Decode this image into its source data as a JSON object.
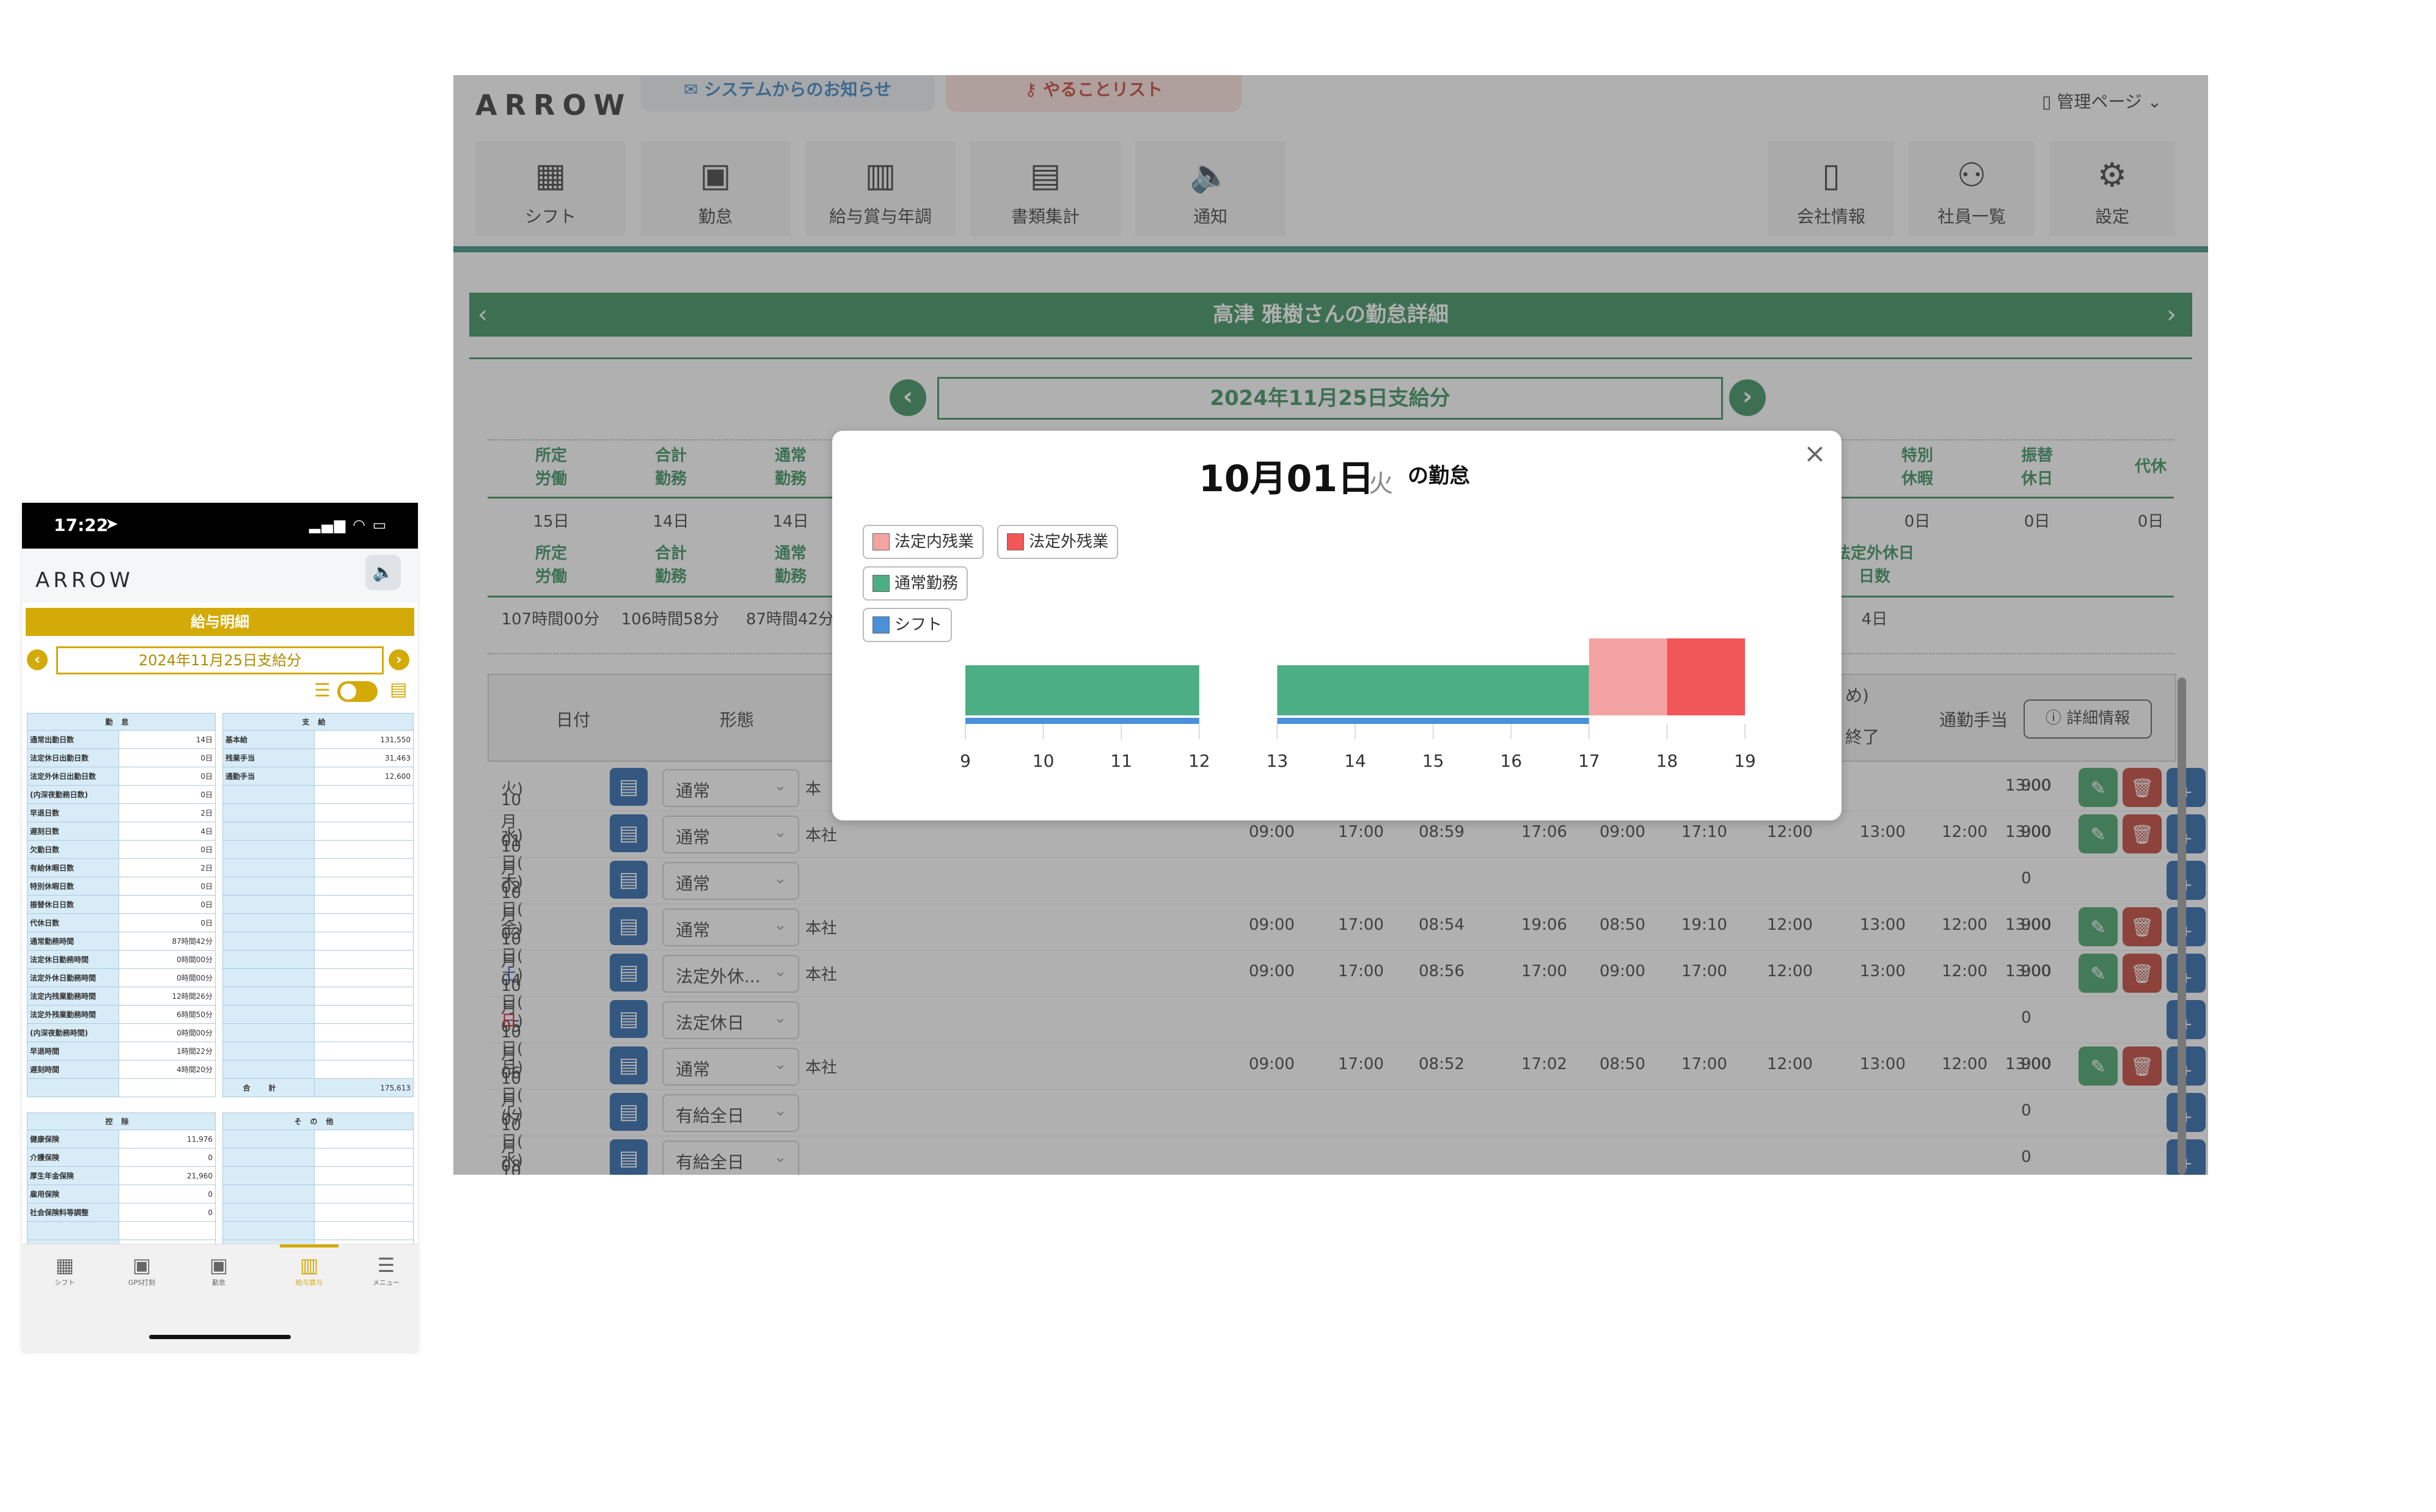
{
  "phone": {
    "status_time": "17:22",
    "logo": "ARROW",
    "title": "給与明細",
    "period": "2024年11月25日支給分",
    "attendance": {
      "header": "勤怠",
      "rows": [
        {
          "label": "通常出勤日数",
          "value": "14日"
        },
        {
          "label": "法定休日出勤日数",
          "value": "0日"
        },
        {
          "label": "法定外休日出勤日数",
          "value": "0日"
        },
        {
          "label": "(内深夜勤務日数)",
          "value": "0日"
        },
        {
          "label": "早退日数",
          "value": "2日"
        },
        {
          "label": "遅刻日数",
          "value": "4日"
        },
        {
          "label": "欠勤日数",
          "value": "0日"
        },
        {
          "label": "有給休暇日数",
          "value": "2日"
        },
        {
          "label": "特別休暇日数",
          "value": "0日"
        },
        {
          "label": "振替休日日数",
          "value": "0日"
        },
        {
          "label": "代休日数",
          "value": "0日"
        },
        {
          "label": "通常勤務時間",
          "value": "87時間42分"
        },
        {
          "label": "法定休日勤務時間",
          "value": "0時間00分"
        },
        {
          "label": "法定外休日勤務時間",
          "value": "0時間00分"
        },
        {
          "label": "法定内残業勤務時間",
          "value": "12時間26分"
        },
        {
          "label": "法定外残業勤務時間",
          "value": "6時間50分"
        },
        {
          "label": "(内深夜勤務時間)",
          "value": "0時間00分"
        },
        {
          "label": "早退時間",
          "value": "1時間22分"
        },
        {
          "label": "遅刻時間",
          "value": "4時間20分"
        }
      ]
    },
    "payment": {
      "header": "支給",
      "rows": [
        {
          "label": "基本給",
          "value": "131,550"
        },
        {
          "label": "残業手当",
          "value": "31,463"
        },
        {
          "label": "通勤手当",
          "value": "12,600"
        }
      ],
      "total_label": "合計",
      "total_value": "175,613"
    },
    "deduction": {
      "header": "控除",
      "rows": [
        {
          "label": "健康保険",
          "value": "11,976"
        },
        {
          "label": "介護保険",
          "value": "0"
        },
        {
          "label": "厚生年金保険",
          "value": "21,960"
        },
        {
          "label": "雇用保険",
          "value": "0"
        },
        {
          "label": "社会保険料等調整",
          "value": "0"
        }
      ]
    },
    "other": {
      "header": "その他"
    },
    "tabs": [
      {
        "label": "シフト",
        "icon": "calendar-icon"
      },
      {
        "label": "GPS打刻",
        "icon": "briefcase-icon"
      },
      {
        "label": "勤怠",
        "icon": "briefcase-icon"
      },
      {
        "label": "給与賞与",
        "icon": "calculator-icon"
      },
      {
        "label": "メニュー",
        "icon": "menu-icon"
      }
    ]
  },
  "desktop": {
    "logo": "ARROW",
    "notice_tab": "システムからのお知らせ",
    "todo_tab": "やることリスト",
    "admin_menu": "管理ページ",
    "nav": [
      {
        "label": "シフト",
        "icon": "calendar-icon"
      },
      {
        "label": "勤怠",
        "icon": "briefcase-icon"
      },
      {
        "label": "給与賞与年調",
        "icon": "calculator-icon"
      },
      {
        "label": "書類集計",
        "icon": "document-icon"
      },
      {
        "label": "通知",
        "icon": "speaker-icon"
      }
    ],
    "nav_right": [
      {
        "label": "会社情報",
        "icon": "building-icon"
      },
      {
        "label": "社員一覧",
        "icon": "users-icon"
      },
      {
        "label": "設定",
        "icon": "gear-icon"
      }
    ],
    "banner_title": "高津 雅樹さんの勤怠詳細",
    "period": "2024年11月25日支給分",
    "summary_top": {
      "headers_left": [
        [
          "所定",
          "労働"
        ],
        [
          "合計",
          "勤務"
        ],
        [
          "通常",
          "勤務"
        ]
      ],
      "values_left": [
        "15日",
        "14日",
        "14日"
      ],
      "headers_right": [
        [
          "特別",
          "休暇"
        ],
        [
          "振替",
          "休日"
        ],
        [
          "代休",
          ""
        ]
      ],
      "values_right": [
        "0日",
        "0日",
        "0日"
      ]
    },
    "summary_bottom": {
      "headers_left": [
        [
          "所定",
          "労働"
        ],
        [
          "合計",
          "勤務"
        ],
        [
          "通常",
          "勤務"
        ]
      ],
      "values_left": [
        "107時間00分",
        "106時間58分",
        "87時間42分"
      ],
      "header_right": [
        "法定外休日",
        "日数"
      ],
      "value_right": "4日"
    },
    "grid_headers": {
      "date": "日付",
      "type": "形態",
      "break_partial": "め)",
      "end_partial": "終了",
      "commute": "通勤手当"
    },
    "detail_button": "詳細情報",
    "rows": [
      {
        "date": "10月01日(",
        "dow": "火",
        "close": ")",
        "type": "通常",
        "place": "本",
        "times": [
          "",
          "",
          "",
          "",
          "",
          "",
          "",
          "",
          "",
          "13:00"
        ],
        "commute": "900",
        "actions": true
      },
      {
        "date": "10月02日(",
        "dow": "水",
        "close": ")",
        "type": "通常",
        "place": "本社",
        "times": [
          "09:00",
          "17:00",
          "08:59",
          "17:06",
          "09:00",
          "17:10",
          "12:00",
          "13:00",
          "12:00",
          "13:00"
        ],
        "commute": "900",
        "actions": true
      },
      {
        "date": "10月03日(",
        "dow": "木",
        "close": ")",
        "type": "通常",
        "place": "",
        "times": [
          "",
          "",
          "",
          "",
          "",
          "",
          "",
          "",
          "",
          ""
        ],
        "commute": "0",
        "actions": false
      },
      {
        "date": "10月04日(",
        "dow": "金",
        "close": ")",
        "type": "通常",
        "place": "本社",
        "times": [
          "09:00",
          "17:00",
          "08:54",
          "19:06",
          "08:50",
          "19:10",
          "12:00",
          "13:00",
          "12:00",
          "13:00"
        ],
        "commute": "900",
        "actions": true
      },
      {
        "date": "10月05日(",
        "dow": "土",
        "close": ")",
        "type": "法定外休...",
        "place": "本社",
        "times": [
          "09:00",
          "17:00",
          "08:56",
          "17:00",
          "09:00",
          "17:00",
          "12:00",
          "13:00",
          "12:00",
          "13:00"
        ],
        "commute": "900",
        "actions": true
      },
      {
        "date": "10月06日(",
        "dow": "日",
        "close": ")",
        "type": "法定休日",
        "place": "",
        "times": [
          "",
          "",
          "",
          "",
          "",
          "",
          "",
          "",
          "",
          ""
        ],
        "commute": "0",
        "actions": false
      },
      {
        "date": "10月07日(",
        "dow": "月",
        "close": ")",
        "type": "通常",
        "place": "本社",
        "times": [
          "09:00",
          "17:00",
          "08:52",
          "17:02",
          "08:50",
          "17:00",
          "12:00",
          "13:00",
          "12:00",
          "13:00"
        ],
        "commute": "900",
        "actions": true
      },
      {
        "date": "10月08日(",
        "dow": "火",
        "close": ")",
        "type": "有給全日",
        "place": "",
        "times": [
          "",
          "",
          "",
          "",
          "",
          "",
          "",
          "",
          "",
          ""
        ],
        "commute": "0",
        "actions": false
      },
      {
        "date": "10月09日(",
        "dow": "水",
        "close": ")",
        "type": "有給全日",
        "place": "",
        "times": [
          "",
          "",
          "",
          "",
          "",
          "",
          "",
          "",
          "",
          ""
        ],
        "commute": "0",
        "actions": false
      }
    ]
  },
  "modal": {
    "date": "10月01日",
    "dow": "火",
    "suffix": "の勤怠",
    "legend": [
      {
        "label": "法定内残業",
        "color": "#f4a3a3"
      },
      {
        "label": "法定外残業",
        "color": "#f25757"
      },
      {
        "label": "通常勤務",
        "color": "#4cae84"
      },
      {
        "label": "シフト",
        "color": "#4a90d9"
      }
    ]
  },
  "chart_data": {
    "type": "bar",
    "orientation": "horizontal-timeline",
    "x_ticks": [
      "9",
      "10",
      "11",
      "12",
      "13",
      "14",
      "15",
      "16",
      "17",
      "18",
      "19"
    ],
    "xlim": [
      9,
      19
    ],
    "series": [
      {
        "name": "通常勤務",
        "color": "#4cae84",
        "segments": [
          [
            9,
            12
          ],
          [
            13,
            17
          ]
        ]
      },
      {
        "name": "法定内残業",
        "color": "#f4a3a3",
        "segments": [
          [
            17,
            18
          ]
        ]
      },
      {
        "name": "法定外残業",
        "color": "#f25757",
        "segments": [
          [
            18,
            19
          ]
        ]
      },
      {
        "name": "シフト",
        "color": "#4a90d9",
        "segments": [
          [
            9,
            12
          ],
          [
            13,
            17
          ]
        ]
      }
    ]
  }
}
